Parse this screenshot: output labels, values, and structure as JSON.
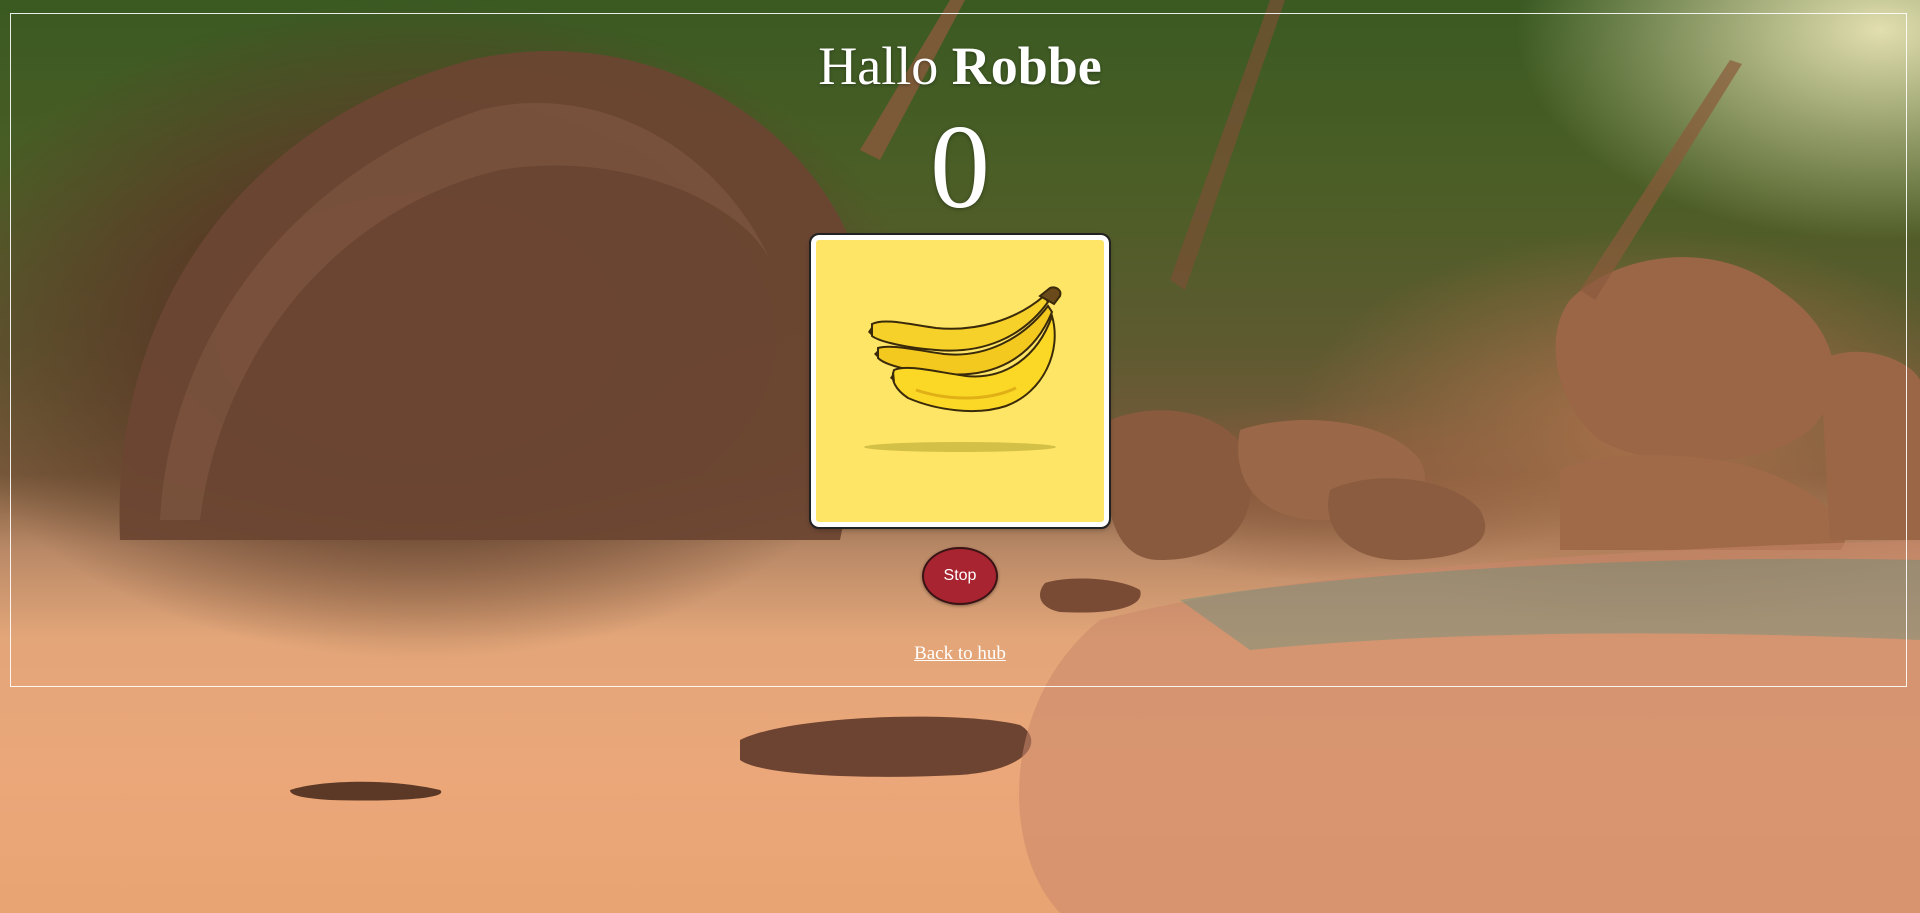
{
  "header": {
    "greeting_prefix": "Hallo",
    "user_name": "Robbe"
  },
  "game": {
    "score": "0",
    "card_image": "banana-icon",
    "card_background": "#fee565"
  },
  "controls": {
    "stop_label": "Stop",
    "stop_color": "#a72430"
  },
  "footer": {
    "back_link_label": "Back to hub"
  },
  "background": {
    "scene": "tropical-beach-sunset-image"
  }
}
